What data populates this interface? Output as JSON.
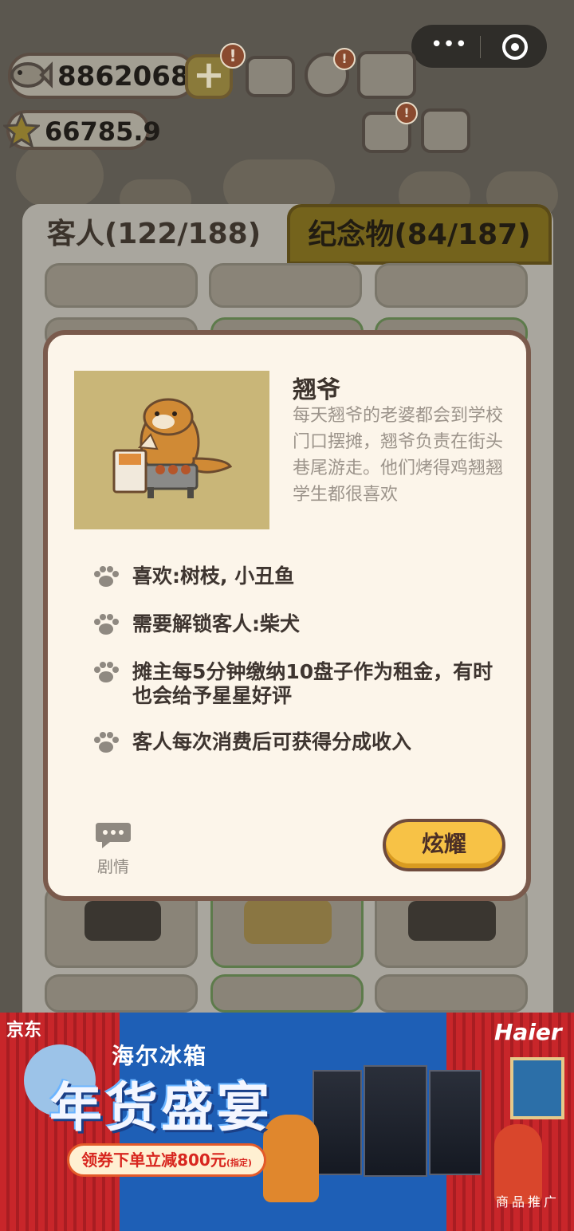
{
  "hud": {
    "fish_count": "8862068",
    "star_count": "66785.9",
    "plus_label": "+",
    "badge_mark": "!"
  },
  "tabs": {
    "guests_label": "客人(122/188)",
    "souvenirs_label": "纪念物(84/187)"
  },
  "character": {
    "name": "翘爷",
    "description": "每天翘爷的老婆都会到学校门口摆摊，翘爷负责在街头巷尾游走。他们烤得鸡翘翘学生都很喜欢",
    "info": [
      "喜欢:树枝, 小丑鱼",
      "需要解锁客人:柴犬",
      "摊主每5分钟缴纳10盘子作为租金，有时也会给予星星好评",
      "客人每次消费后可获得分成收入"
    ]
  },
  "modal_actions": {
    "story_label": "剧情",
    "boast_label": "炫耀"
  },
  "ad": {
    "brand_left": "京东",
    "brand_right": "Haier",
    "title": "海尔冰箱",
    "headline": "年货盛宴",
    "coupon": "领券下单立减800元",
    "coupon_note": "(指定)",
    "promo_tag": "商品推广"
  },
  "colors": {
    "modal_bg": "#fcf5ea",
    "boast_button": "#f7c246",
    "active_tab": "#a9a69e",
    "inactive_tab": "#74631c"
  },
  "icons": [
    "fish-icon",
    "star-icon",
    "plus-icon",
    "leaderboard-icon",
    "settings-icon",
    "album-icon",
    "news-icon",
    "gamepad-icon",
    "paw-icon",
    "chat-bubble-icon",
    "more-icon",
    "target-icon"
  ]
}
